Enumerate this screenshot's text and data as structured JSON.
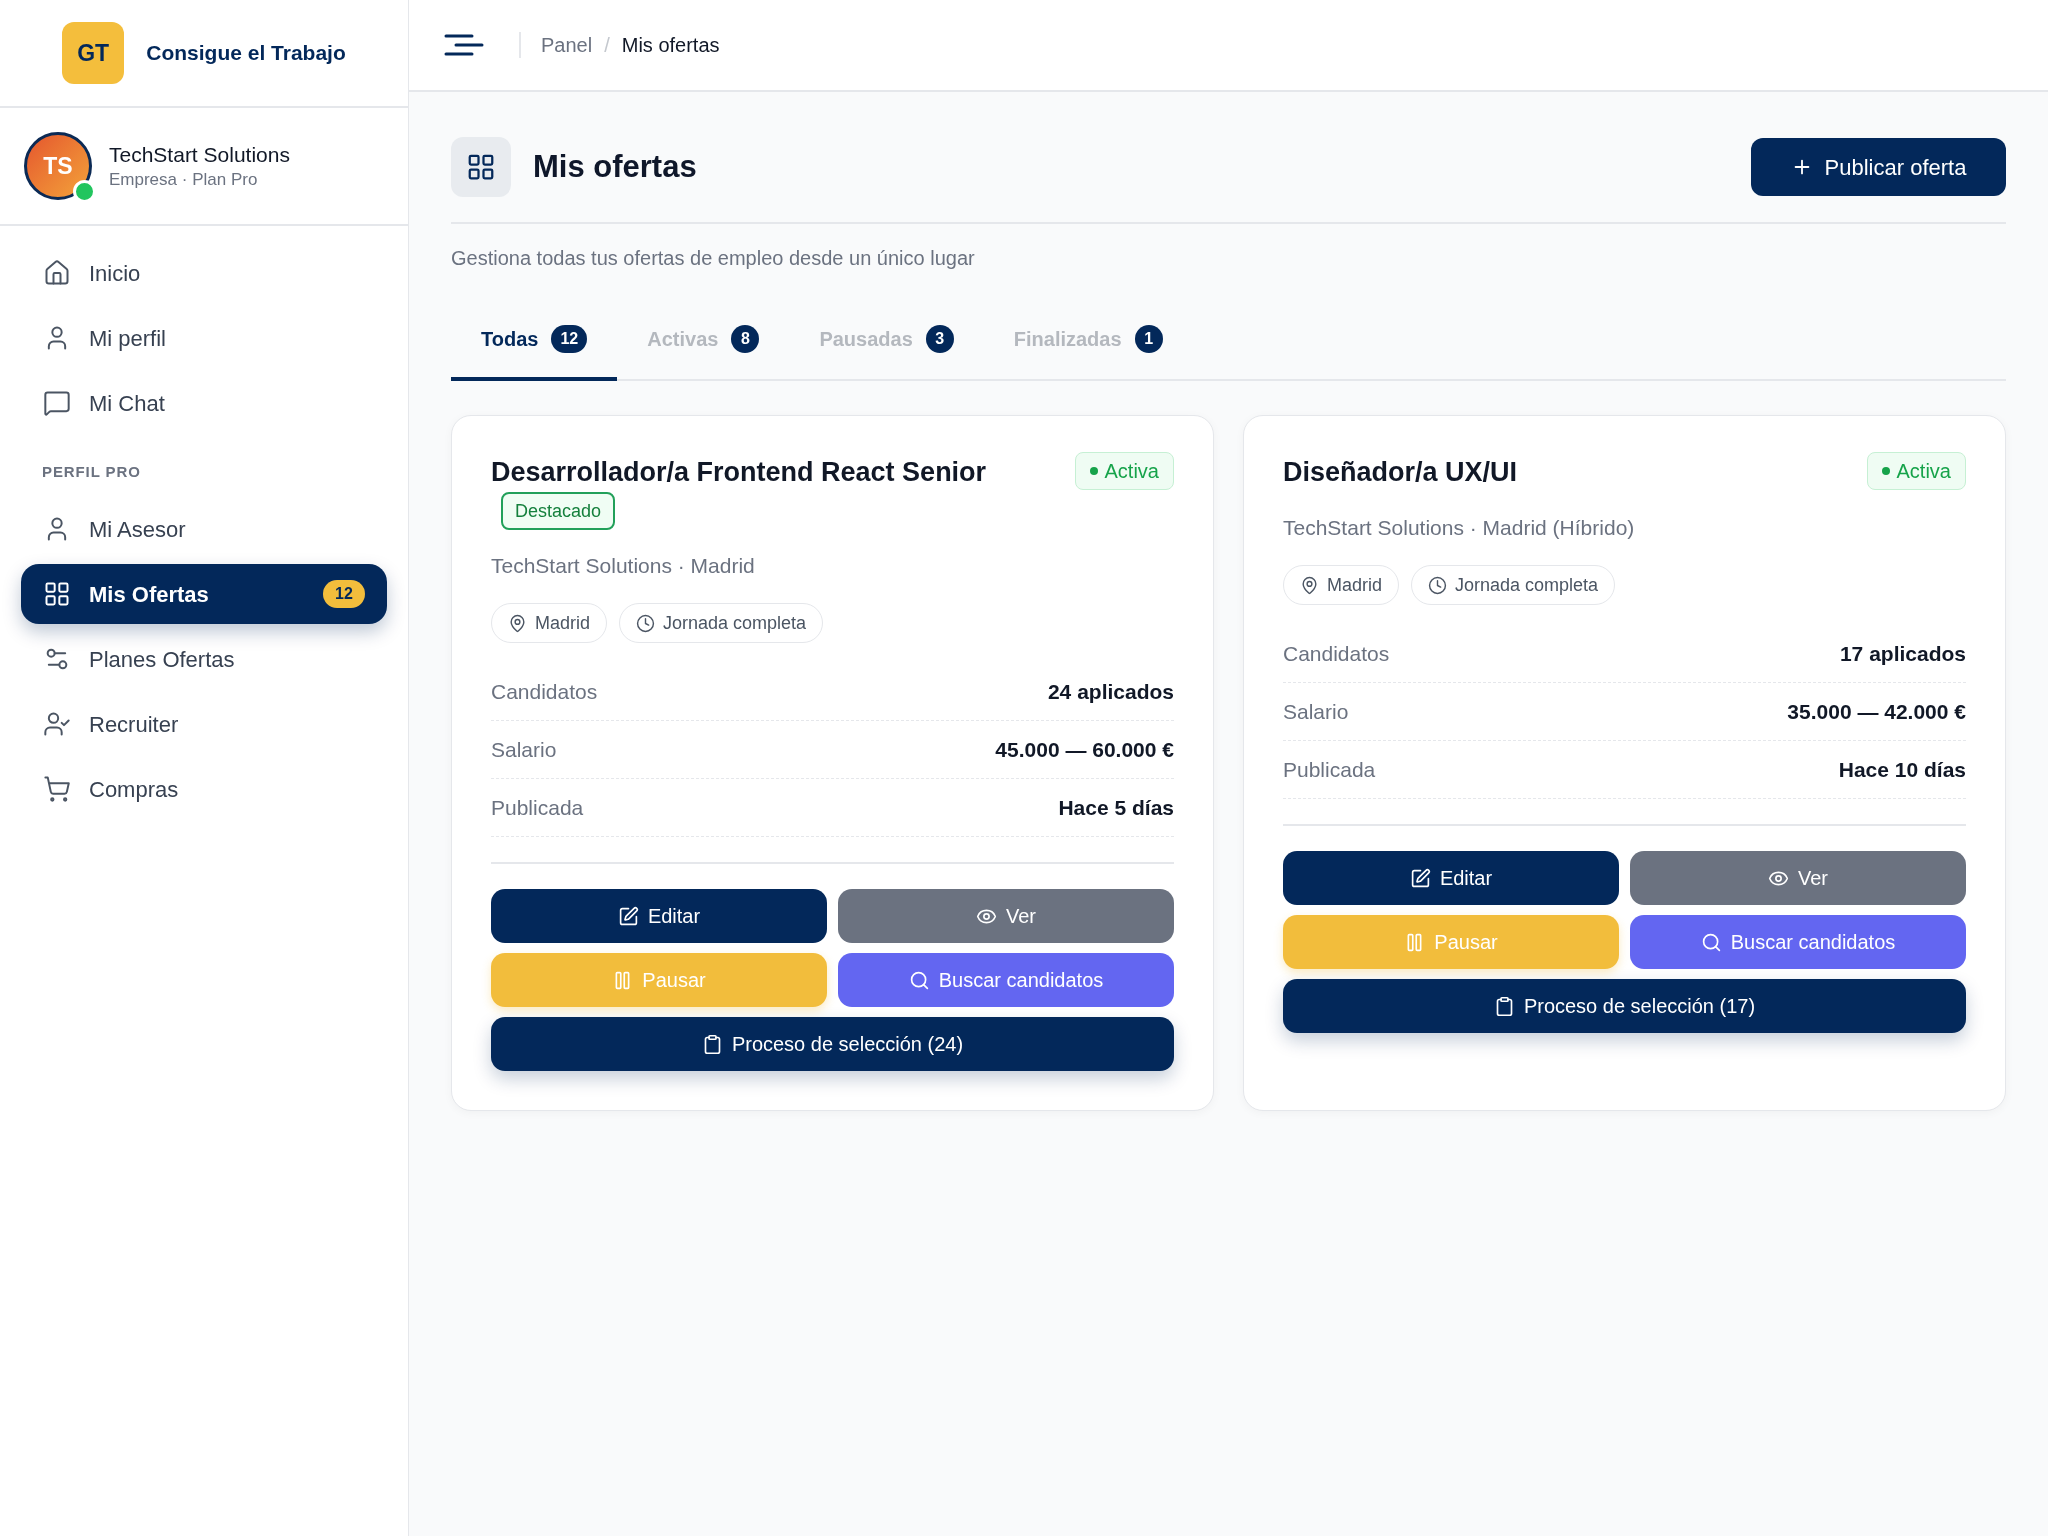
{
  "sidebar": {
    "logo": {
      "mark": "GT",
      "name": "Consigue el Trabajo"
    },
    "account": {
      "initials": "TS",
      "name": "TechStart Solutions",
      "subtitle": "Empresa · Plan Pro",
      "online": true
    },
    "nav": [
      {
        "label": "Inicio",
        "selected": false
      },
      {
        "label": "Mi perfil",
        "selected": false
      },
      {
        "label": "Mi Chat",
        "selected": false
      }
    ],
    "sections": [
      {
        "heading": "PERFIL PRO",
        "items": [
          {
            "label": "Mi Asesor",
            "selected": false
          },
          {
            "label": "Mis Ofertas",
            "selected": true,
            "badge": "12"
          },
          {
            "label": "Planes Ofertas",
            "selected": false
          },
          {
            "label": "Recruiter",
            "selected": false
          },
          {
            "label": "Compras",
            "selected": false
          }
        ]
      }
    ]
  },
  "header": {
    "breadcrumb": [
      {
        "label": "Panel",
        "selected": false
      },
      {
        "label": "Mis ofertas",
        "selected": true
      }
    ],
    "separator": "/"
  },
  "page": {
    "title": "Mis ofertas",
    "action": "Publicar oferta",
    "subtitle": "Gestiona todas tus ofertas de empleo desde un único lugar",
    "tabs": [
      {
        "label": "Todas",
        "count": "12",
        "selected": true
      },
      {
        "label": "Activas",
        "count": "8",
        "selected": false
      },
      {
        "label": "Pausadas",
        "count": "3",
        "selected": false
      },
      {
        "label": "Finalizadas",
        "count": "1",
        "selected": false
      }
    ],
    "offers": [
      {
        "title": "Desarrollador/a Frontend React Senior",
        "status": "Activa",
        "tag": "Destacado",
        "company": "TechStart Solutions · Madrid",
        "chips": [
          {
            "kind": "location",
            "label": "Madrid"
          },
          {
            "kind": "schedule",
            "label": "Jornada completa"
          }
        ],
        "stats": [
          {
            "label": "Candidatos",
            "value": "24 aplicados"
          },
          {
            "label": "Salario",
            "value": "45.000 — 60.000 €"
          },
          {
            "label": "Publicada",
            "value": "Hace 5 días"
          }
        ],
        "actions": [
          {
            "kind": "edit",
            "label": "Editar"
          },
          {
            "kind": "view",
            "label": "Ver"
          },
          {
            "kind": "pause",
            "label": "Pausar"
          },
          {
            "kind": "search",
            "label": "Buscar candidatos"
          },
          {
            "kind": "process",
            "label": "Proceso de selección (24)"
          }
        ]
      },
      {
        "title": "Diseñador/a UX/UI",
        "status": "Activa",
        "company": "TechStart Solutions · Madrid (Híbrido)",
        "chips": [
          {
            "kind": "location",
            "label": "Madrid"
          },
          {
            "kind": "schedule",
            "label": "Jornada completa"
          }
        ],
        "stats": [
          {
            "label": "Candidatos",
            "value": "17 aplicados"
          },
          {
            "label": "Salario",
            "value": "35.000 — 42.000 €"
          },
          {
            "label": "Publicada",
            "value": "Hace 10 días"
          }
        ],
        "actions": [
          {
            "kind": "edit",
            "label": "Editar"
          },
          {
            "kind": "view",
            "label": "Ver"
          },
          {
            "kind": "pause",
            "label": "Pausar"
          },
          {
            "kind": "search",
            "label": "Buscar candidatos"
          },
          {
            "kind": "process",
            "label": "Proceso de selección (17)"
          }
        ]
      }
    ]
  }
}
